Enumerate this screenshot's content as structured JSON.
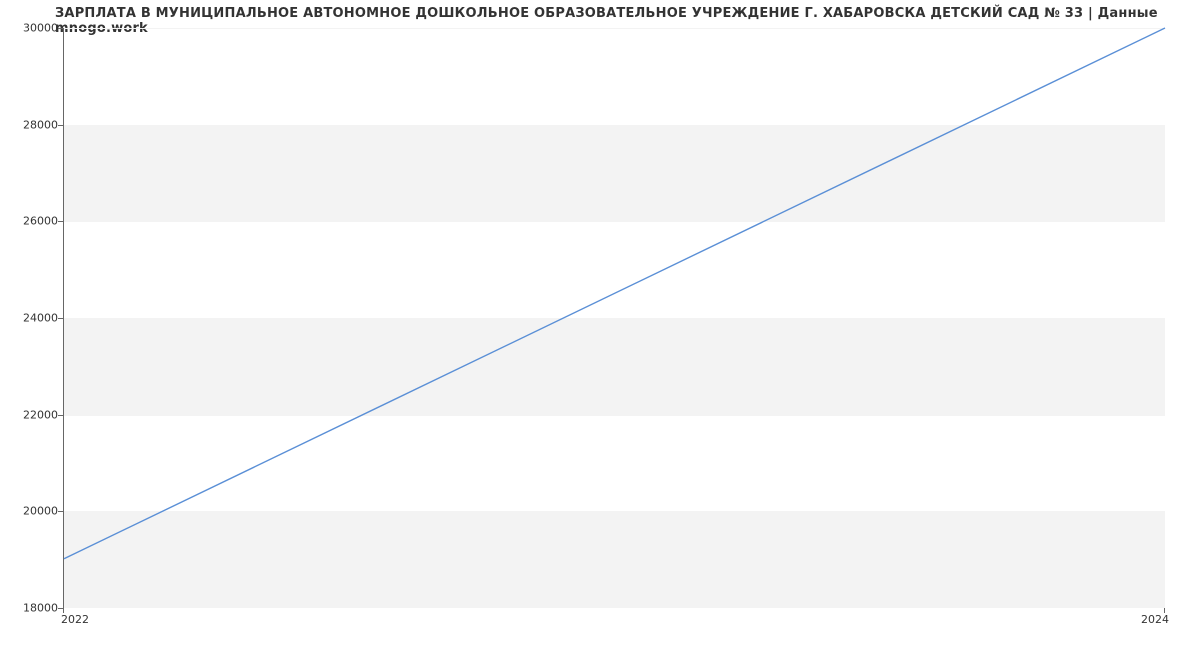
{
  "chart_data": {
    "type": "line",
    "title": "ЗАРПЛАТА В МУНИЦИПАЛЬНОЕ АВТОНОМНОЕ ДОШКОЛЬНОЕ ОБРАЗОВАТЕЛЬНОЕ УЧРЕЖДЕНИЕ Г. ХАБАРОВСКА ДЕТСКИЙ САД № 33 | Данные mnogo.work",
    "x": [
      2022,
      2024
    ],
    "values": [
      19000,
      30000
    ],
    "xlabel": "",
    "ylabel": "",
    "xlim": [
      2022,
      2024
    ],
    "ylim": [
      18000,
      30000
    ],
    "yticks": [
      18000,
      20000,
      22000,
      24000,
      26000,
      28000,
      30000
    ],
    "xticks": [
      2022,
      2024
    ],
    "line_color": "#5a8fd6"
  },
  "labels": {
    "y": {
      "t18000": "18000",
      "t20000": "20000",
      "t22000": "22000",
      "t24000": "24000",
      "t26000": "26000",
      "t28000": "28000",
      "t30000": "30000"
    },
    "x": {
      "t2022": "2022",
      "t2024": "2024"
    }
  }
}
